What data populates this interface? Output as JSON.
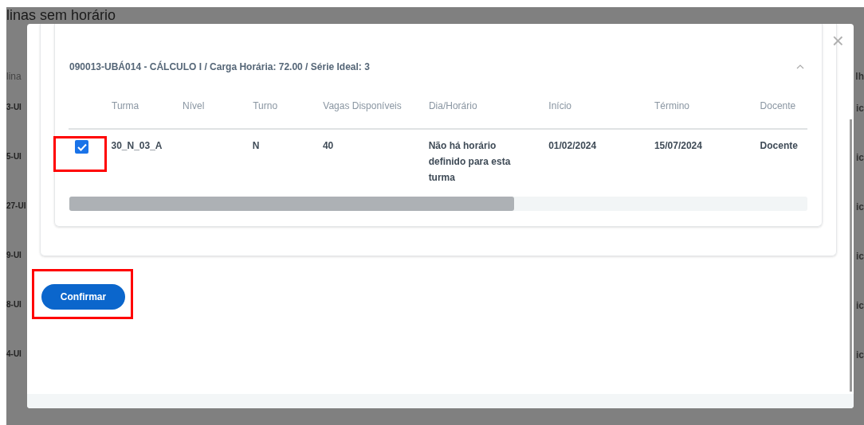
{
  "background_page": {
    "title": "linas sem horário",
    "column_1": "lina",
    "column_2": "lh",
    "rows": [
      {
        "code": "3-UI",
        "end": "ic"
      },
      {
        "code": "5-UI",
        "end": "ic"
      },
      {
        "code": "27-UI",
        "end": "ic"
      },
      {
        "code": "9-UI",
        "end": "ic"
      },
      {
        "code": "8-UI",
        "end": "ic"
      },
      {
        "code": "4-UI",
        "end": "ic"
      }
    ]
  },
  "modal": {
    "close": "×",
    "course": {
      "header": "090013-UBÁ014 - CÁLCULO I / Carga Horária: 72.00 / Série Ideal: 3",
      "expanded": true,
      "columns": [
        "Turma",
        "Nível",
        "Turno",
        "Vagas Disponíveis",
        "Dia/Horário",
        "Início",
        "Término",
        "Docente"
      ],
      "rows": [
        {
          "checked": true,
          "highlighted": true,
          "cells": [
            "30_N_03_A",
            "",
            "N",
            "40",
            "Não há horário definido para esta turma",
            "01/02/2024",
            "15/07/2024",
            "Docente"
          ]
        }
      ]
    },
    "confirm_button": {
      "label": "Confirmar",
      "highlighted": true
    }
  }
}
